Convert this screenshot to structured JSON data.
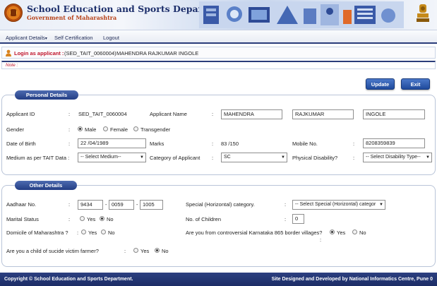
{
  "header": {
    "department": "School Education and Sports Department",
    "government": "Government of Maharashtra"
  },
  "nav": {
    "items": [
      "Applicant Details",
      "Self Certification",
      "Logout"
    ]
  },
  "login": {
    "label": "Login as applicant :",
    "id": "(SED_TAIT_0060004)",
    "name": "MAHENDRA RAJKUMAR INGOLE"
  },
  "note": {
    "label": "Note :"
  },
  "buttons": {
    "update": "Update",
    "exit": "Exit"
  },
  "personal": {
    "title": "Personal Details",
    "applicant_id_label": "Applicant ID",
    "applicant_id": "SED_TAIT_0060004",
    "applicant_name_label": "Applicant Name",
    "first_name": "MAHENDRA",
    "middle_name": "RAJKUMAR",
    "last_name": "INGOLE",
    "gender_label": "Gender",
    "gender_options": [
      "Male",
      "Female",
      "Transgender"
    ],
    "gender_selected": "Male",
    "dob_label": "Date of Birth",
    "dob": "22 /04/1989",
    "marks_label": "Marks",
    "marks": "83 /150",
    "mobile_label": "Mobile No.",
    "mobile": "8208359839",
    "medium_label": "Medium as per TAIT Data :",
    "medium_value": "-- Select Medium--",
    "category_label": "Category of Applicant",
    "category_value": "SC",
    "disability_label": "Physical Disability?",
    "disability_value": "-- Select Disability Type--"
  },
  "other": {
    "title": "Other Details",
    "aadhaar_label": "Aadhaar No.",
    "aadhaar_1": "9434",
    "aadhaar_2": "0059",
    "aadhaar_3": "1005",
    "special_label": "Special (Horizontal) category.",
    "special_value": "-- Select Special (Horizontal) categor",
    "marital_label": "Marital Status",
    "marital_options": [
      "Yes",
      "No"
    ],
    "marital_selected": "No",
    "children_label": "No. of Children",
    "children_value": "0",
    "domicile_label": "Domicile of Maharashtra ?",
    "domicile_options": [
      "Yes",
      "No"
    ],
    "border_label": "Are you from controversial Karnataka 865 border villages?",
    "border_options": [
      "Yes",
      "No"
    ],
    "border_selected": "Yes",
    "farmer_label": "Are you a child of sucide victim farmer?",
    "farmer_options": [
      "Yes",
      "No"
    ],
    "farmer_selected": "No"
  },
  "footer": {
    "left": "Copyright © School Education and Sports Department.",
    "right": "Site Designed and Developed by National Informatics Centre, Pune 0"
  },
  "colors": {
    "header_navy": "#1d2f6b",
    "accent_red": "#c0142b",
    "button_blue": "#1f4a9c"
  }
}
